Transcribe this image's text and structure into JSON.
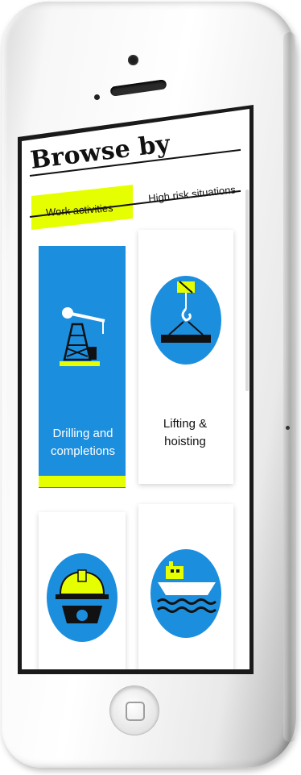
{
  "screen": {
    "title": "Browse by",
    "tabs": [
      {
        "label": "Work activities",
        "active": true
      },
      {
        "label": "High risk situations",
        "active": false
      }
    ],
    "cards": [
      {
        "label": "Drilling and completions",
        "icon": "oil-rig-icon",
        "selected": true
      },
      {
        "label": "Lifting & hoisting",
        "icon": "crane-hook-icon",
        "selected": false
      },
      {
        "label": "",
        "icon": "hard-hat-gear-icon",
        "selected": false
      },
      {
        "label": "",
        "icon": "boat-icon",
        "selected": false
      }
    ]
  },
  "colors": {
    "accent_blue": "#1c8ede",
    "accent_yellow": "#e6ff00",
    "text_dark": "#111111"
  }
}
